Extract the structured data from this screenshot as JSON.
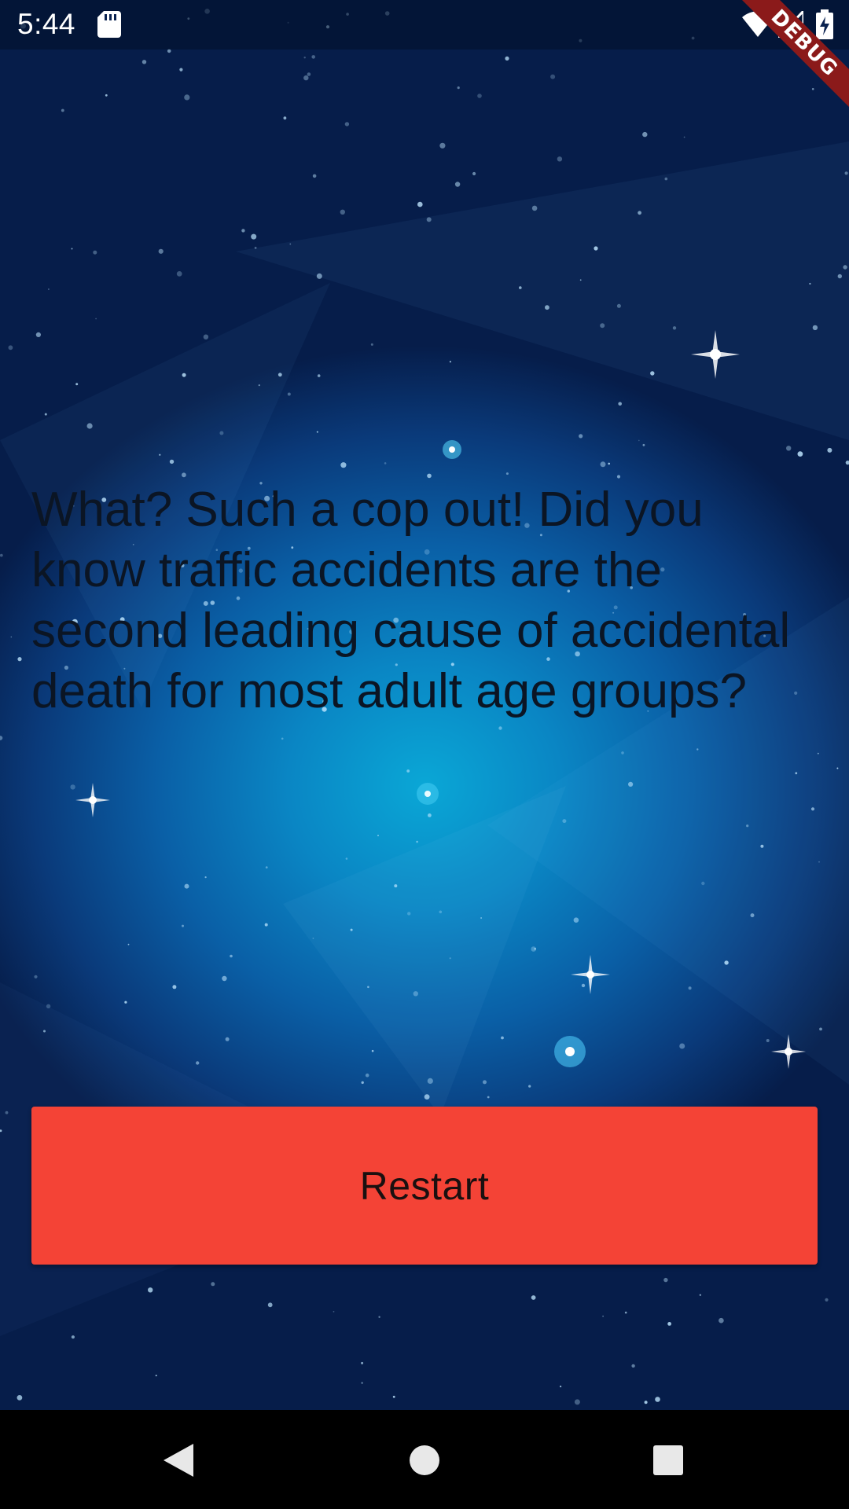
{
  "status_bar": {
    "time": "5:44",
    "icons": [
      "sd-card-icon",
      "wifi-icon",
      "cell-signal-icon",
      "battery-charging-icon"
    ]
  },
  "debug_banner": {
    "label": "DEBUG",
    "color": "#8b1a1a"
  },
  "question": {
    "text": "What? Such a cop out! Did you know traffic accidents are the second leading cause of accidental death for most adult age groups?"
  },
  "restart_button": {
    "label": "Restart",
    "color": "#f44336"
  },
  "nav_bar": {
    "icons": [
      "back-icon",
      "home-icon",
      "recents-icon"
    ]
  },
  "colors": {
    "background_center": "#0aa7d6",
    "background_edge": "#061d4a",
    "text": "#0b1524"
  }
}
